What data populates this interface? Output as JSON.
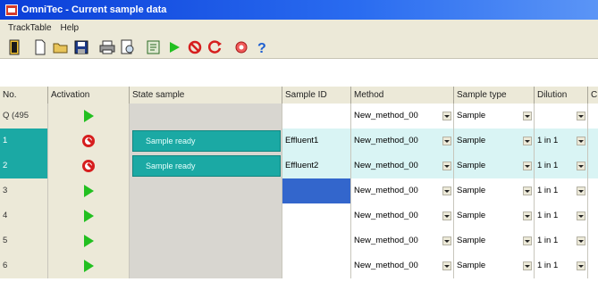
{
  "window": {
    "title": "OmniTec - Current sample data"
  },
  "menu": [
    "TrackTable",
    "Help"
  ],
  "toolbar_icons": [
    "exit-icon",
    "new-icon",
    "open-icon",
    "save-icon",
    "print-icon",
    "print-preview-icon",
    "export-icon",
    "run-icon",
    "stop-icon",
    "reset-icon",
    "record-icon",
    "help-icon"
  ],
  "columns": [
    "No.",
    "Activation",
    "State sample",
    "Sample ID",
    "Method",
    "Sample type",
    "Dilution",
    "C"
  ],
  "rows": [
    {
      "no": "Q (495",
      "activation": "play",
      "state": "",
      "sample_id": "",
      "method": "New_method_00",
      "type": "Sample",
      "dilution": "",
      "style": "q"
    },
    {
      "no": "1",
      "activation": "stop",
      "state": "Sample ready",
      "sample_id": "Effluent1",
      "method": "New_method_00",
      "type": "Sample",
      "dilution": "1 in 1",
      "style": "ready"
    },
    {
      "no": "2",
      "activation": "stop",
      "state": "Sample ready",
      "sample_id": "Effluent2",
      "method": "New_method_00",
      "type": "Sample",
      "dilution": "1 in 1",
      "style": "ready"
    },
    {
      "no": "3",
      "activation": "play",
      "state": "",
      "sample_id": "",
      "method": "New_method_00",
      "type": "Sample",
      "dilution": "1 in 1",
      "style": "selected"
    },
    {
      "no": "4",
      "activation": "play",
      "state": "",
      "sample_id": "",
      "method": "New_method_00",
      "type": "Sample",
      "dilution": "1 in 1",
      "style": "normal"
    },
    {
      "no": "5",
      "activation": "play",
      "state": "",
      "sample_id": "",
      "method": "New_method_00",
      "type": "Sample",
      "dilution": "1 in 1",
      "style": "normal"
    },
    {
      "no": "6",
      "activation": "play",
      "state": "",
      "sample_id": "",
      "method": "New_method_00",
      "type": "Sample",
      "dilution": "1 in 1",
      "style": "normal"
    }
  ]
}
